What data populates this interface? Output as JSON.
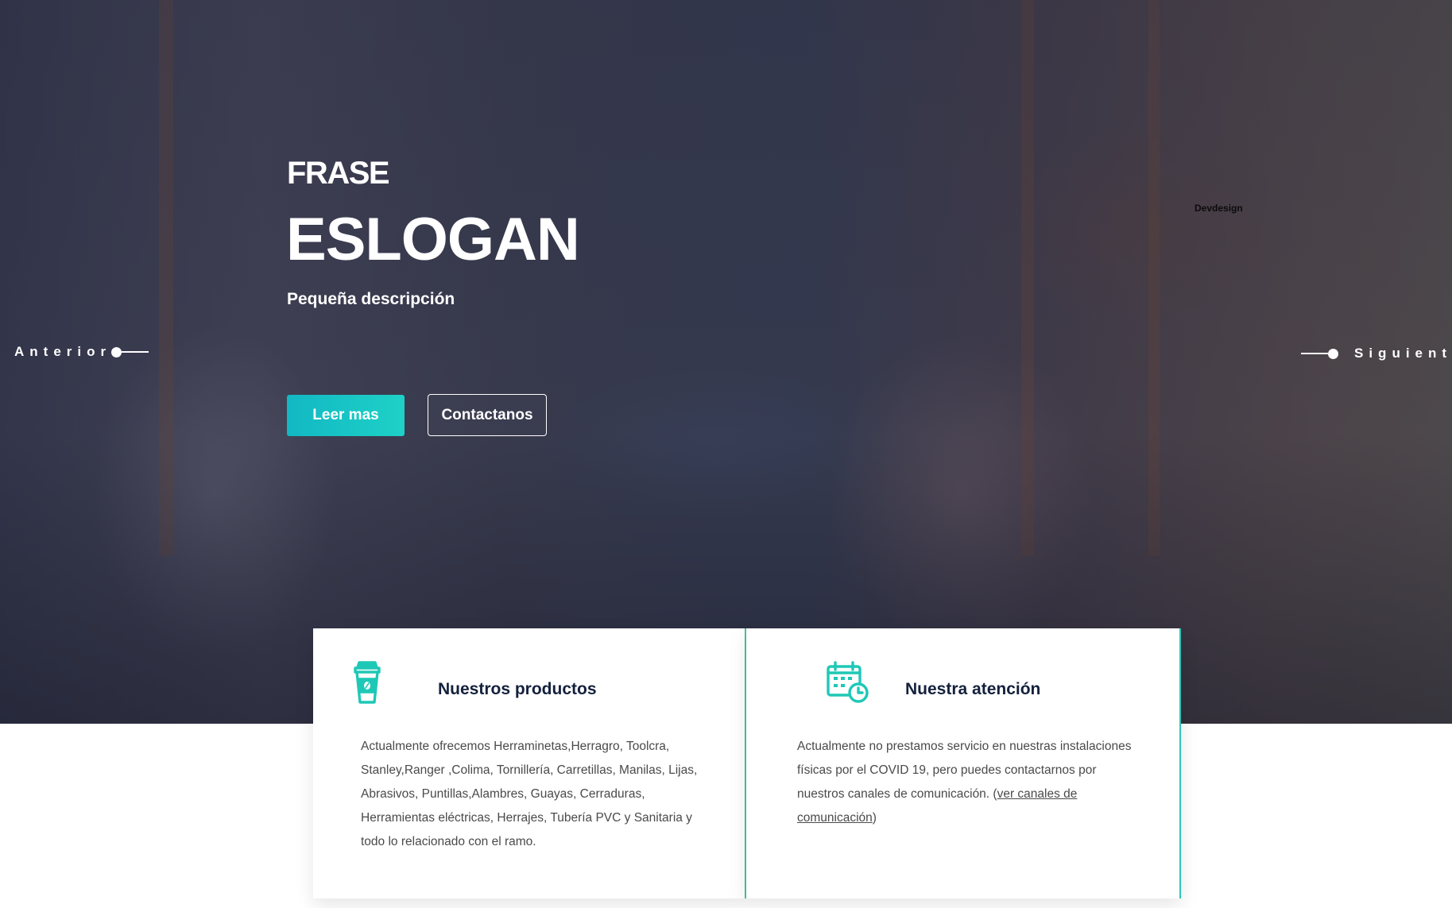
{
  "hero": {
    "phrase": "FRASE",
    "slogan": "ESLOGAN",
    "description": "Pequeña descripción",
    "primary_button": "Leer mas",
    "secondary_button": "Contactanos",
    "prev_label": "Anterior",
    "next_label": "Siguient",
    "watermark": "Devdesign"
  },
  "cards": {
    "products": {
      "icon": "coffee-cup-icon",
      "title": "Nuestros productos",
      "text": "Actualmente ofrecemos  Herraminetas,Herragro, Toolcra, Stanley,Ranger ,Colima, Tornillería, Carretillas, Manilas, Lijas, Abrasivos, Puntillas,Alambres, Guayas, Cerraduras, Herramientas eléctricas, Herrajes, Tubería PVC y Sanitaria y todo lo relacionado con el ramo."
    },
    "attention": {
      "icon": "calendar-clock-icon",
      "title": "Nuestra atención",
      "text_before": "Actualmente no prestamos servicio en nuestras instalaciones físicas por el COVID 19,  pero puedes contactarnos por nuestros canales de comunicación. (",
      "link_text": "ver canales de comunicación",
      "text_after": ")"
    }
  },
  "colors": {
    "accent": "#1ed1c6",
    "title_dark": "#14213d",
    "icon": "#1ec8b6"
  }
}
